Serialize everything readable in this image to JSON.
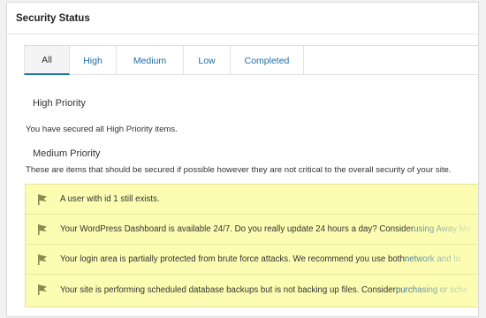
{
  "panel": {
    "title": "Security Status"
  },
  "tabs": [
    {
      "label": "All",
      "active": true
    },
    {
      "label": "High",
      "active": false
    },
    {
      "label": "Medium",
      "active": false
    },
    {
      "label": "Low",
      "active": false
    },
    {
      "label": "Completed",
      "active": false
    }
  ],
  "high": {
    "heading": "High Priority",
    "message": "You have secured all High Priority items."
  },
  "medium": {
    "heading": "Medium Priority",
    "message": "These are items that should be secured if possible however they are not critical to the overall security of your site."
  },
  "warnings": [
    {
      "text": "A user with id 1 still exists.",
      "link": ""
    },
    {
      "text": "Your WordPress Dashboard is available 24/7. Do you really update 24 hours a day? Consider ",
      "link": "using Away Mo"
    },
    {
      "text": "Your login area is partially protected from brute force attacks. We recommend you use both ",
      "link": "network and lo"
    },
    {
      "text": "Your site is performing scheduled database backups but is not backing up files. Consider ",
      "link": "purchasing or sche"
    }
  ],
  "icons": {
    "warning_flag": "flag-icon"
  },
  "colors": {
    "accent": "#1b6fa8",
    "warning_bg": "#fcfcb2",
    "flag": "#8a8a50"
  }
}
